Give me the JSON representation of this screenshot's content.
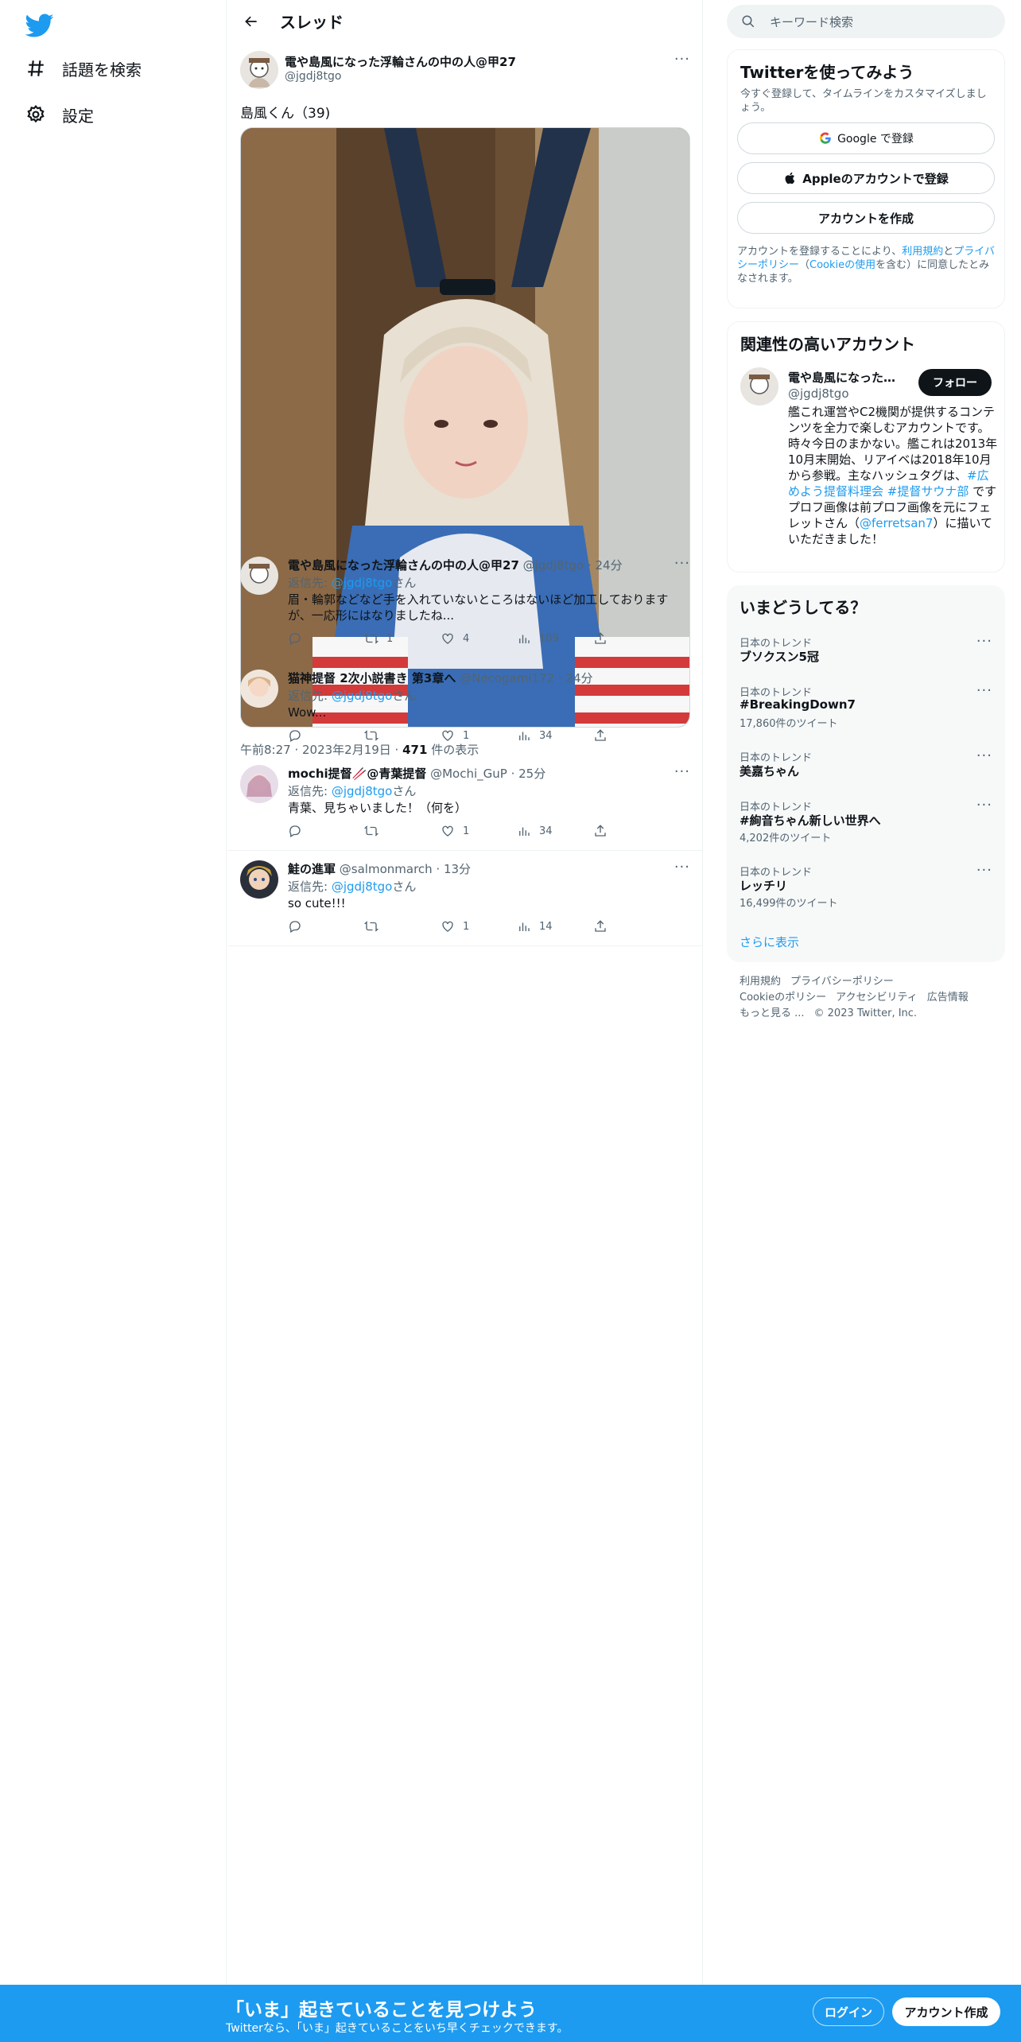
{
  "sidebar": {
    "items": [
      {
        "label": "話題を検索",
        "icon": "hashtag-icon"
      },
      {
        "label": "設定",
        "icon": "gear-icon"
      }
    ]
  },
  "header": {
    "title": "スレッド"
  },
  "tweet": {
    "author_name": "電や島風になった浮輪さんの中の人@甲27",
    "author_handle": "@jgdj8tgo",
    "text": "島風くん（39)",
    "time": "午前8:27 · 2023年2月19日 · ",
    "views": "471",
    "views_suffix": " 件の表示"
  },
  "replies": [
    {
      "name": "電や島風になった浮輪さんの中の人@甲27",
      "handle": "@jgdj8tgo · 24分",
      "reply_prefix": "返信先: ",
      "reply_to": "@jgdj8tgo",
      "reply_suffix": "さん",
      "text": "眉・輪郭などなど手を入れていないところはないほど加工しております が、一応形にはなりましたね...",
      "replies": "",
      "retweets": "1",
      "likes": "4",
      "views": "109"
    },
    {
      "name": "猫神提督 2次小説書き 第3章へ",
      "handle": "@Necogami172 · 24分",
      "reply_prefix": "返信先: ",
      "reply_to": "@jgdj8tgo",
      "reply_suffix": "さん",
      "text": "Wow...",
      "replies": "",
      "retweets": "",
      "likes": "1",
      "views": "34"
    },
    {
      "name": "mochi提督🥢@青葉提督",
      "handle": "@Mochi_GuP · 25分",
      "reply_prefix": "返信先: ",
      "reply_to": "@jgdj8tgo",
      "reply_suffix": "さん",
      "text": "青葉、見ちゃいました！（何を）",
      "replies": "",
      "retweets": "",
      "likes": "1",
      "views": "34"
    },
    {
      "name": "鮭の進軍",
      "handle": "@salmonmarch · 13分",
      "reply_prefix": "返信先: ",
      "reply_to": "@jgdj8tgo",
      "reply_suffix": "さん",
      "text": "so cute!!!",
      "replies": "",
      "retweets": "",
      "likes": "1",
      "views": "14"
    }
  ],
  "search": {
    "placeholder": "キーワード検索"
  },
  "signup": {
    "title": "Twitterを使ってみよう",
    "desc": "今すぐ登録して、タイムラインをカスタマイズしましょう。",
    "google": "Google で登録",
    "apple": "Appleのアカウントで登録",
    "create": "アカウントを作成",
    "legal_1": "アカウントを登録することにより、",
    "legal_terms": "利用規約",
    "legal_2": "と",
    "legal_privacy": "プライバシーポリシー",
    "legal_3": "（",
    "legal_cookie": "Cookieの使用",
    "legal_4": "を含む）に同意したとみなされます。"
  },
  "related": {
    "title": "関連性の高いアカウント",
    "name": "電や島風になった浮...",
    "handle": "@jgdj8tgo",
    "follow": "フォロー",
    "bio_1": "艦これ運営やC2機関が提供するコンテンツを全力で楽しむアカウントです。時々今日のまかない。艦これは2013年10月末開始、リアイベは2018年10月から参戦。主なハッシュタグは、",
    "bio_tag1": "#広めよう提督料理会",
    "bio_tag2": "#提督サウナ部",
    "bio_2": " です プロフ画像は前プロフ画像を元にフェレットさん（",
    "bio_link": "@ferretsan7",
    "bio_3": "）に描いていただきました！"
  },
  "trends": {
    "title": "いまどうしてる？",
    "items": [
      {
        "category": "日本のトレンド",
        "name": "ブソクスン5冠",
        "count": ""
      },
      {
        "category": "日本のトレンド",
        "name": "#BreakingDown7",
        "count": "17,860件のツイート"
      },
      {
        "category": "日本のトレンド",
        "name": "美嘉ちゃん",
        "count": ""
      },
      {
        "category": "日本のトレンド",
        "name": "#絢音ちゃん新しい世界へ",
        "count": "4,202件のツイート"
      },
      {
        "category": "日本のトレンド",
        "name": "レッチリ",
        "count": "16,499件のツイート"
      }
    ],
    "show_more": "さらに表示"
  },
  "footer": {
    "links": [
      "利用規約",
      "プライバシーポリシー",
      "Cookieのポリシー",
      "アクセシビリティ",
      "広告情報",
      "もっと見る ...",
      "© 2023 Twitter, Inc."
    ]
  },
  "bottom_bar": {
    "title": "「いま」起きていることを見つけよう",
    "subtitle": "Twitterなら、「いま」起きていることをいち早くチェックできます。",
    "login": "ログイン",
    "signup": "アカウント作成"
  },
  "colors": {
    "accent": "#1d9bf0",
    "text": "#0f1419",
    "muted": "#536471"
  }
}
